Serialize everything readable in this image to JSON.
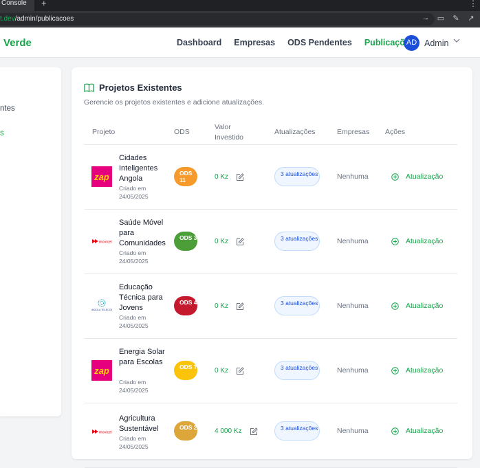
{
  "browser": {
    "tab_label": "Console",
    "new_tab": "+",
    "menu": "⋮",
    "url_host": "t.dev",
    "url_path": "/admin/publicacoes"
  },
  "navbar": {
    "brand": "Verde",
    "links": [
      "Dashboard",
      "Empresas",
      "ODS Pendentes",
      "Publicações"
    ],
    "avatar_initials": "AD",
    "user_name": "Admin"
  },
  "sidebar": {
    "items": [
      "ntes",
      "s"
    ]
  },
  "card": {
    "title": "Projetos Existentes",
    "subtitle": "Gerencie os projetos existentes e adicione atualizações.",
    "columns": [
      "Projeto",
      "ODS",
      "Valor\nInvestido",
      "Atualizações",
      "Empresas",
      "Ações"
    ]
  },
  "projects": [
    {
      "name": "Cidades Inteligentes Angola",
      "created": "Criado em 24/05/2025",
      "logo": "zap-logo",
      "ods": "ODS 11",
      "ods_color": "#f59a2b",
      "valor": "0 Kz",
      "updates": "3 atualizações",
      "empresas": "Nenhuma",
      "acao": "Atualização"
    },
    {
      "name": "Saúde Móvel para Comunidades",
      "created": "Criado em 24/05/2025",
      "logo": "movicel-logo",
      "ods": "ODS 3",
      "ods_color": "#4c9f38",
      "valor": "0 Kz",
      "updates": "3 atualizações",
      "empresas": "Nenhuma",
      "acao": "Atualização"
    },
    {
      "name": "Educação Técnica para Jovens",
      "created": "Criado em 24/05/2025",
      "logo": "globe-logo",
      "ods": "ODS 4",
      "ods_color": "#c5192d",
      "valor": "0 Kz",
      "updates": "3 atualizações",
      "empresas": "Nenhuma",
      "acao": "Atualização"
    },
    {
      "name": "Energia Solar para Escolas",
      "created": "Criado em 24/05/2025",
      "logo": "zap-logo",
      "ods": "ODS 7",
      "ods_color": "#fcc30b",
      "valor": "0 Kz",
      "updates": "3 atualizações",
      "empresas": "Nenhuma",
      "acao": "Atualização"
    },
    {
      "name": "Agricultura Sustentável",
      "created": "Criado em 24/05/2025",
      "logo": "movicel-logo",
      "ods": "ODS 2",
      "ods_color": "#dda63a",
      "valor": "4 000 Kz",
      "updates": "3 atualizações",
      "empresas": "Nenhuma",
      "acao": "Atualização"
    }
  ],
  "colors": {
    "accent": "#16a34a",
    "avatar": "#1d4ed8",
    "badge_bg": "#eff6ff"
  }
}
